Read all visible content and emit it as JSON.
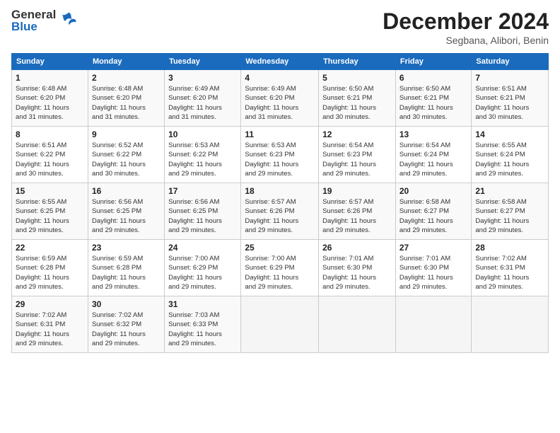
{
  "header": {
    "logo_line1": "General",
    "logo_line2": "Blue",
    "month": "December 2024",
    "location": "Segbana, Alibori, Benin"
  },
  "weekdays": [
    "Sunday",
    "Monday",
    "Tuesday",
    "Wednesday",
    "Thursday",
    "Friday",
    "Saturday"
  ],
  "weeks": [
    [
      {
        "day": "1",
        "info": "Sunrise: 6:48 AM\nSunset: 6:20 PM\nDaylight: 11 hours\nand 31 minutes."
      },
      {
        "day": "2",
        "info": "Sunrise: 6:48 AM\nSunset: 6:20 PM\nDaylight: 11 hours\nand 31 minutes."
      },
      {
        "day": "3",
        "info": "Sunrise: 6:49 AM\nSunset: 6:20 PM\nDaylight: 11 hours\nand 31 minutes."
      },
      {
        "day": "4",
        "info": "Sunrise: 6:49 AM\nSunset: 6:20 PM\nDaylight: 11 hours\nand 31 minutes."
      },
      {
        "day": "5",
        "info": "Sunrise: 6:50 AM\nSunset: 6:21 PM\nDaylight: 11 hours\nand 30 minutes."
      },
      {
        "day": "6",
        "info": "Sunrise: 6:50 AM\nSunset: 6:21 PM\nDaylight: 11 hours\nand 30 minutes."
      },
      {
        "day": "7",
        "info": "Sunrise: 6:51 AM\nSunset: 6:21 PM\nDaylight: 11 hours\nand 30 minutes."
      }
    ],
    [
      {
        "day": "8",
        "info": "Sunrise: 6:51 AM\nSunset: 6:22 PM\nDaylight: 11 hours\nand 30 minutes."
      },
      {
        "day": "9",
        "info": "Sunrise: 6:52 AM\nSunset: 6:22 PM\nDaylight: 11 hours\nand 30 minutes."
      },
      {
        "day": "10",
        "info": "Sunrise: 6:53 AM\nSunset: 6:22 PM\nDaylight: 11 hours\nand 29 minutes."
      },
      {
        "day": "11",
        "info": "Sunrise: 6:53 AM\nSunset: 6:23 PM\nDaylight: 11 hours\nand 29 minutes."
      },
      {
        "day": "12",
        "info": "Sunrise: 6:54 AM\nSunset: 6:23 PM\nDaylight: 11 hours\nand 29 minutes."
      },
      {
        "day": "13",
        "info": "Sunrise: 6:54 AM\nSunset: 6:24 PM\nDaylight: 11 hours\nand 29 minutes."
      },
      {
        "day": "14",
        "info": "Sunrise: 6:55 AM\nSunset: 6:24 PM\nDaylight: 11 hours\nand 29 minutes."
      }
    ],
    [
      {
        "day": "15",
        "info": "Sunrise: 6:55 AM\nSunset: 6:25 PM\nDaylight: 11 hours\nand 29 minutes."
      },
      {
        "day": "16",
        "info": "Sunrise: 6:56 AM\nSunset: 6:25 PM\nDaylight: 11 hours\nand 29 minutes."
      },
      {
        "day": "17",
        "info": "Sunrise: 6:56 AM\nSunset: 6:25 PM\nDaylight: 11 hours\nand 29 minutes."
      },
      {
        "day": "18",
        "info": "Sunrise: 6:57 AM\nSunset: 6:26 PM\nDaylight: 11 hours\nand 29 minutes."
      },
      {
        "day": "19",
        "info": "Sunrise: 6:57 AM\nSunset: 6:26 PM\nDaylight: 11 hours\nand 29 minutes."
      },
      {
        "day": "20",
        "info": "Sunrise: 6:58 AM\nSunset: 6:27 PM\nDaylight: 11 hours\nand 29 minutes."
      },
      {
        "day": "21",
        "info": "Sunrise: 6:58 AM\nSunset: 6:27 PM\nDaylight: 11 hours\nand 29 minutes."
      }
    ],
    [
      {
        "day": "22",
        "info": "Sunrise: 6:59 AM\nSunset: 6:28 PM\nDaylight: 11 hours\nand 29 minutes."
      },
      {
        "day": "23",
        "info": "Sunrise: 6:59 AM\nSunset: 6:28 PM\nDaylight: 11 hours\nand 29 minutes."
      },
      {
        "day": "24",
        "info": "Sunrise: 7:00 AM\nSunset: 6:29 PM\nDaylight: 11 hours\nand 29 minutes."
      },
      {
        "day": "25",
        "info": "Sunrise: 7:00 AM\nSunset: 6:29 PM\nDaylight: 11 hours\nand 29 minutes."
      },
      {
        "day": "26",
        "info": "Sunrise: 7:01 AM\nSunset: 6:30 PM\nDaylight: 11 hours\nand 29 minutes."
      },
      {
        "day": "27",
        "info": "Sunrise: 7:01 AM\nSunset: 6:30 PM\nDaylight: 11 hours\nand 29 minutes."
      },
      {
        "day": "28",
        "info": "Sunrise: 7:02 AM\nSunset: 6:31 PM\nDaylight: 11 hours\nand 29 minutes."
      }
    ],
    [
      {
        "day": "29",
        "info": "Sunrise: 7:02 AM\nSunset: 6:31 PM\nDaylight: 11 hours\nand 29 minutes."
      },
      {
        "day": "30",
        "info": "Sunrise: 7:02 AM\nSunset: 6:32 PM\nDaylight: 11 hours\nand 29 minutes."
      },
      {
        "day": "31",
        "info": "Sunrise: 7:03 AM\nSunset: 6:33 PM\nDaylight: 11 hours\nand 29 minutes."
      },
      {
        "day": "",
        "info": ""
      },
      {
        "day": "",
        "info": ""
      },
      {
        "day": "",
        "info": ""
      },
      {
        "day": "",
        "info": ""
      }
    ]
  ]
}
